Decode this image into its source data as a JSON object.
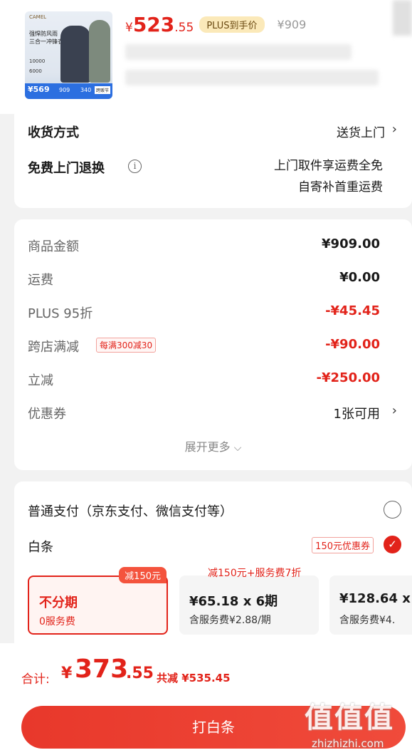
{
  "product": {
    "brand": "CAMEL",
    "slogan_line1": "强悍防风雨",
    "slogan_line2": "三合一冲锋衣",
    "stat1": "10000",
    "stat2": "6000",
    "thumb_price": "¥569",
    "thumb_price2": "909",
    "thumb_price3": "340",
    "thumb_tag": "跨贩节",
    "price_symbol": "¥",
    "price_int": "523",
    "price_dec": ".55",
    "plus_label": "PLUS到手价",
    "original_price": "¥909"
  },
  "delivery": {
    "method_label": "收货方式",
    "method_value": "送货上门",
    "return_label": "免费上门退换",
    "return_line1": "上门取件享运费全免",
    "return_line2": "自寄补首重运费"
  },
  "amount": {
    "rows": [
      {
        "label": "商品金额",
        "value": "¥909.00"
      },
      {
        "label": "运费",
        "value": "¥0.00"
      },
      {
        "label": "PLUS 95折",
        "value": "-¥45.45"
      },
      {
        "label": "跨店满减",
        "value": "-¥90.00"
      },
      {
        "label": "立减",
        "value": "-¥250.00"
      },
      {
        "label": "优惠券",
        "value": "1张可用"
      }
    ],
    "cross_store_tag": "每满300减30",
    "expand_label": "展开更多"
  },
  "payment": {
    "normal_label": "普通支付（京东支付、微信支付等）",
    "baitiao_label": "白条",
    "coupon_tag": "150元优惠券",
    "plans": [
      {
        "title": "不分期",
        "subtitle": "0服务费",
        "badge": "减150元"
      },
      {
        "title": "¥65.18 x 6期",
        "subtitle": "含服务费¥2.88/期",
        "badge": "减150元+服务费7折"
      },
      {
        "title": "¥128.64 x",
        "subtitle": "含服务费¥4.",
        "badge": ""
      }
    ]
  },
  "bottom": {
    "total_label": "合计:",
    "total_yen": "¥",
    "total_int": "373",
    "total_dec": ".55",
    "total_save": "共减 ¥535.45",
    "pay_button": "打白条"
  },
  "watermark": {
    "big": "值值值",
    "small": "zhizhizhi.com"
  },
  "colors": {
    "accent": "#e2231a",
    "plus_badge_bg": "#fbe9b9",
    "page_bg": "#f2f2f2"
  }
}
